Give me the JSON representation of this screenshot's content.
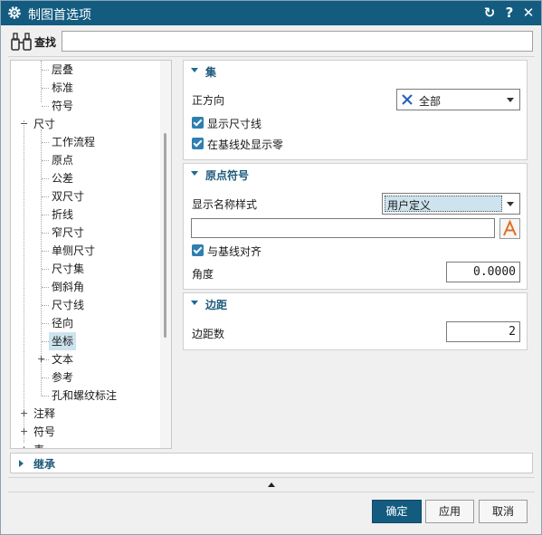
{
  "window": {
    "title": "制图首选项",
    "buttons": {
      "refresh": "↻",
      "help": "?",
      "close": "✕"
    }
  },
  "search": {
    "label": "查找",
    "value": "",
    "placeholder": ""
  },
  "tree": {
    "items": [
      {
        "label": "层叠"
      },
      {
        "label": "标准"
      },
      {
        "label": "符号"
      },
      {
        "label": "尺寸",
        "expander": "−"
      },
      {
        "label": "工作流程"
      },
      {
        "label": "原点"
      },
      {
        "label": "公差"
      },
      {
        "label": "双尺寸"
      },
      {
        "label": "折线"
      },
      {
        "label": "窄尺寸"
      },
      {
        "label": "单侧尺寸"
      },
      {
        "label": "尺寸集"
      },
      {
        "label": "倒斜角"
      },
      {
        "label": "尺寸线"
      },
      {
        "label": "径向"
      },
      {
        "label": "坐标",
        "selected": true
      },
      {
        "label": "文本",
        "expander": "+"
      },
      {
        "label": "参考"
      },
      {
        "label": "孔和螺纹标注"
      },
      {
        "label": "注释",
        "expander": "+"
      },
      {
        "label": "符号",
        "expander": "+"
      },
      {
        "label": "表",
        "expander": "+"
      }
    ]
  },
  "sections": {
    "set": {
      "title": "集",
      "orientation_label": "正方向",
      "orientation_value": "全部",
      "orientation_icon": "xy-cross-icon",
      "show_dimension_line": {
        "label": "显示尺寸线",
        "checked": true
      },
      "show_zero_at_baseline": {
        "label": "在基线处显示零",
        "checked": true
      }
    },
    "origin_symbol": {
      "title": "原点符号",
      "name_style_label": "显示名称样式",
      "name_style_value": "用户定义",
      "name_text": "",
      "align_with_baseline": {
        "label": "与基线对齐",
        "checked": true
      },
      "angle_label": "角度",
      "angle_value": "0.0000"
    },
    "margin": {
      "title": "边距",
      "margin_count_label": "边距数",
      "margin_count_value": "2"
    }
  },
  "inherit": {
    "title": "继承"
  },
  "footer": {
    "ok": "确定",
    "apply": "应用",
    "cancel": "取消"
  },
  "colors": {
    "titlebar": "#135c80",
    "accent": "#1c6a92",
    "selection": "#cde3ed",
    "checkbox": "#2f7fb0",
    "text_style_icon": "#e07020"
  }
}
